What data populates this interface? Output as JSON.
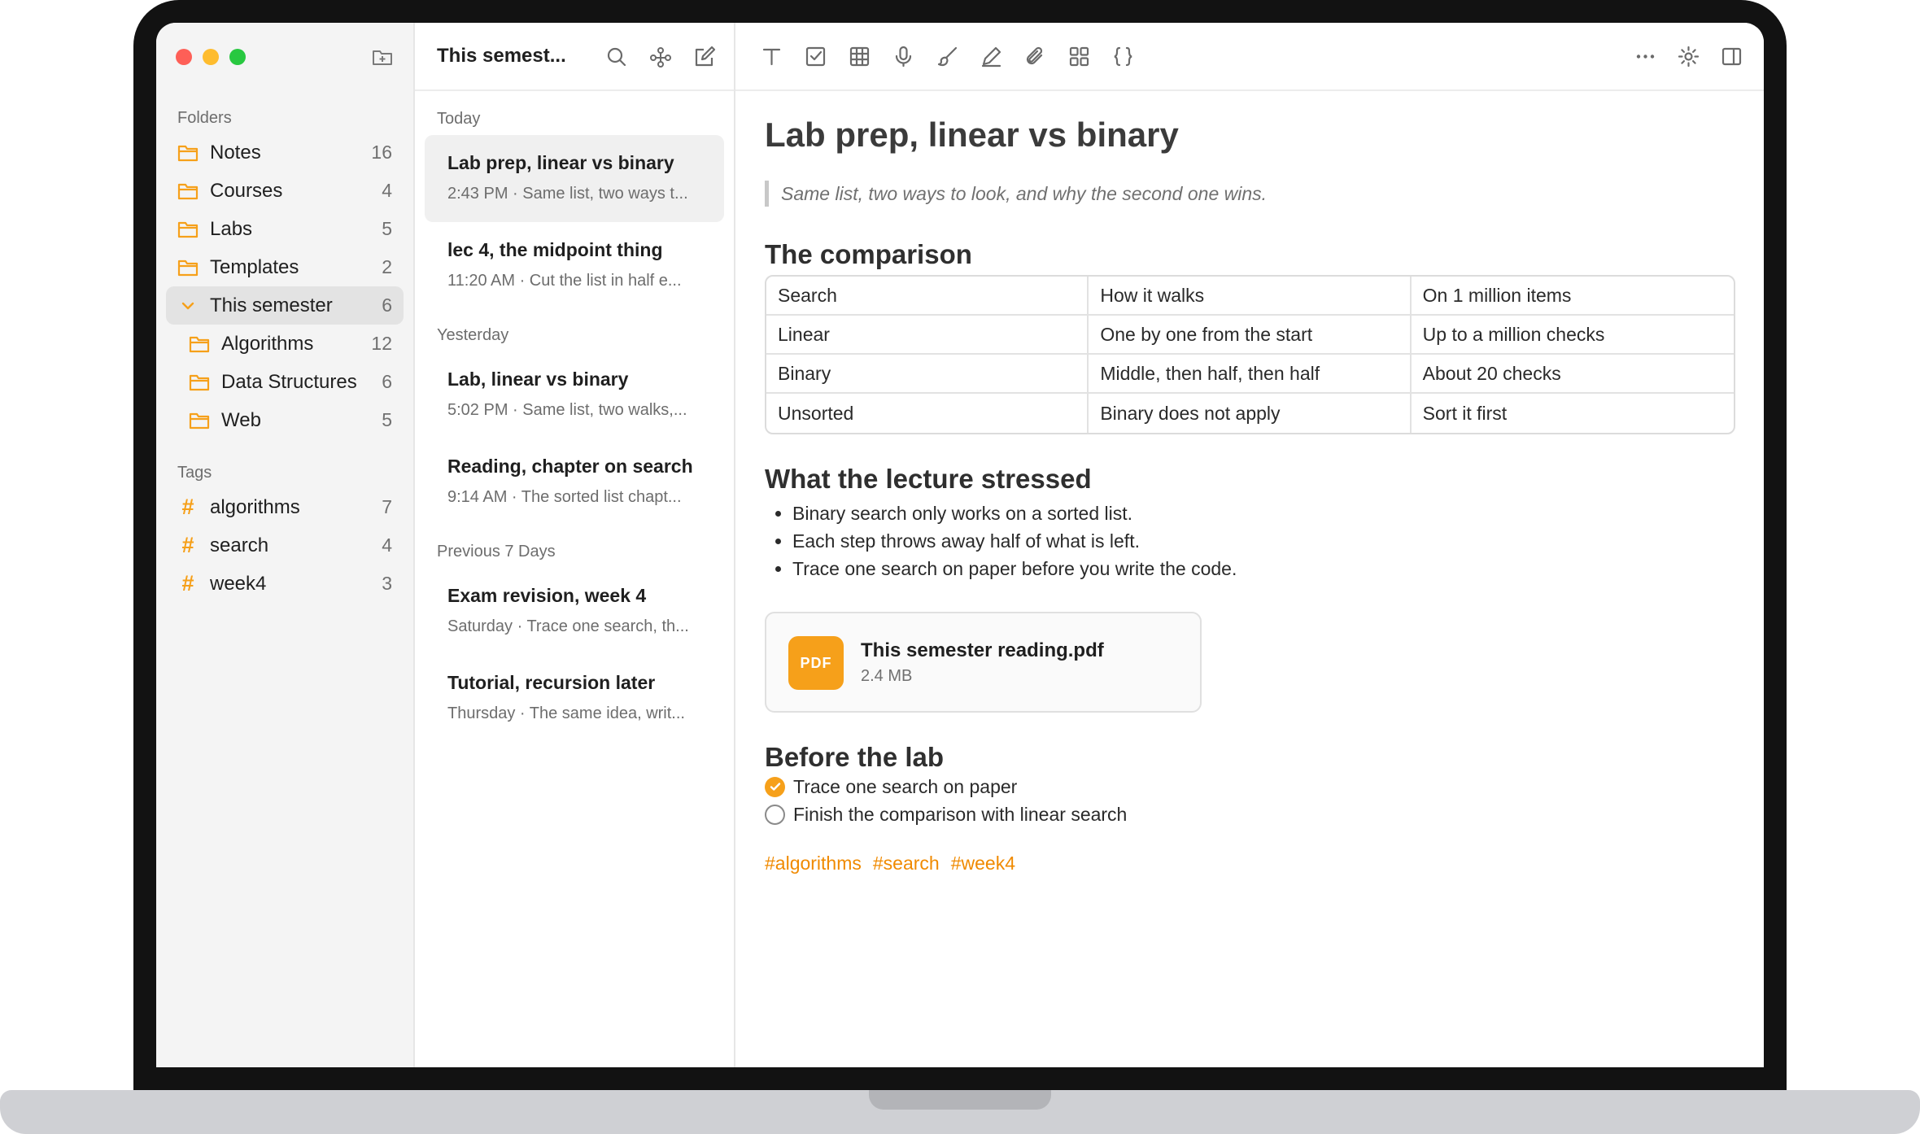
{
  "sidebar": {
    "folders_title": "Folders",
    "folders": [
      {
        "label": "Notes",
        "count": "16"
      },
      {
        "label": "Courses",
        "count": "4"
      },
      {
        "label": "Labs",
        "count": "5"
      },
      {
        "label": "Templates",
        "count": "2"
      },
      {
        "label": "This semester",
        "count": "6"
      },
      {
        "label": "Algorithms",
        "count": "12"
      },
      {
        "label": "Data Structures",
        "count": "6"
      },
      {
        "label": "Web",
        "count": "5"
      }
    ],
    "tags_title": "Tags",
    "tags": [
      {
        "label": "algorithms",
        "count": "7"
      },
      {
        "label": "search",
        "count": "4"
      },
      {
        "label": "week4",
        "count": "3"
      }
    ]
  },
  "notelist": {
    "title": "This semest...",
    "groups": [
      {
        "label": "Today",
        "notes": [
          {
            "title": "Lab prep, linear vs binary",
            "meta": "2:43 PM · Same list, two ways t..."
          },
          {
            "title": "lec 4, the midpoint thing",
            "meta": "11:20 AM · Cut the list in half e..."
          }
        ]
      },
      {
        "label": "Yesterday",
        "notes": [
          {
            "title": "Lab, linear vs binary",
            "meta": "5:02 PM · Same list, two walks,..."
          },
          {
            "title": "Reading, chapter on search",
            "meta": "9:14 AM · The sorted list chapt..."
          }
        ]
      },
      {
        "label": "Previous 7 Days",
        "notes": [
          {
            "title": "Exam revision, week 4",
            "meta": "Saturday · Trace one search, th..."
          },
          {
            "title": "Tutorial, recursion later",
            "meta": "Thursday · The same idea, writ..."
          }
        ]
      }
    ]
  },
  "editor": {
    "title": "Lab prep, linear vs binary",
    "quote": "Same list, two ways to look, and why the second one wins.",
    "comparison_heading": "The comparison",
    "table": [
      [
        "Search",
        "How it walks",
        "On 1 million items"
      ],
      [
        "Linear",
        "One by one from the start",
        "Up to a million checks"
      ],
      [
        "Binary",
        "Middle, then half, then half",
        "About 20 checks"
      ],
      [
        "Unsorted",
        "Binary does not apply",
        "Sort it first"
      ]
    ],
    "lecture_heading": "What the lecture stressed",
    "bullets": [
      "Binary search only works on a sorted list.",
      "Each step throws away half of what is left.",
      "Trace one search on paper before you write the code."
    ],
    "attachment": {
      "badge": "PDF",
      "name": "This semester reading.pdf",
      "size": "2.4 MB"
    },
    "lab_heading": "Before the lab",
    "checklist": [
      {
        "text": "Trace one search on paper",
        "done": true
      },
      {
        "text": "Finish the comparison with linear search",
        "done": false
      }
    ],
    "tags": [
      "#algorithms",
      "#search",
      "#week4"
    ]
  },
  "colors": {
    "accent": "#f6a01a",
    "tag_text": "#f08a00",
    "sidebar_bg": "#f4f4f4"
  }
}
